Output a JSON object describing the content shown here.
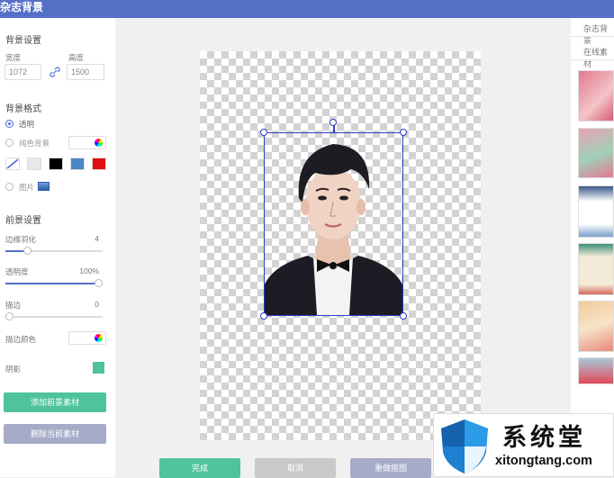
{
  "window": {
    "title": "杂志背景"
  },
  "left_panel": {
    "bg_settings_title": "背景设置",
    "width_label": "宽度",
    "height_label": "高度",
    "width_value": "1072",
    "height_value": "1500",
    "bg_format_title": "背景格式",
    "opt_transparent": "透明",
    "opt_solid": "纯色背景",
    "opt_image": "图片",
    "swatch_colors": [
      "#e8e8e8",
      "#000000",
      "#4a86c8",
      "#e01010"
    ],
    "fg_settings_title": "前景设置",
    "feather_label": "边缘羽化",
    "feather_value": "4",
    "feather_fraction": 0.2,
    "opacity_label": "透明度",
    "opacity_value": "100%",
    "opacity_fraction": 1.0,
    "stroke_label": "描边",
    "stroke_value": "0",
    "stroke_fraction": 0.0,
    "stroke_color_label": "描边颜色",
    "shadow_label": "阴影",
    "shadow_color": "#4fc49a",
    "add_fg_button": "添加前景素材",
    "delete_fg_button": "删除当前素材"
  },
  "bottom_buttons": {
    "done": "完成",
    "cancel": "取消",
    "redo_cutout": "重做抠图"
  },
  "right_panel": {
    "tab_title": "杂志背景",
    "online_label": "在线素材"
  },
  "watermark": {
    "brand": "系统堂",
    "url": "xitongtang.com"
  },
  "colors": {
    "accent": "#5470c6",
    "green": "#4fc49a",
    "gray_button": "#a6acc8",
    "selection": "#2e3fc1"
  }
}
